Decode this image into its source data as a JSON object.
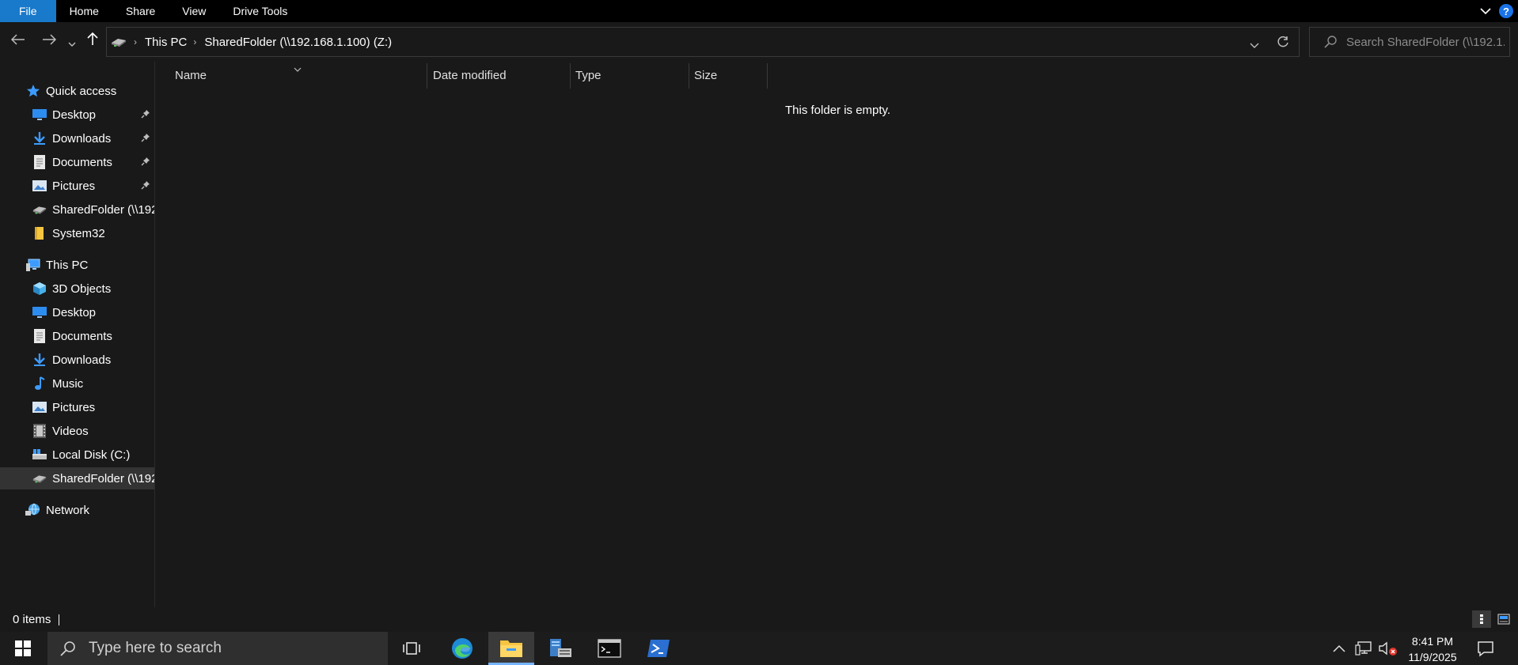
{
  "ribbon": {
    "tabs": [
      "File",
      "Home",
      "Share",
      "View",
      "Drive Tools"
    ]
  },
  "address": {
    "crumbs": [
      "This PC",
      "SharedFolder (\\\\192.168.1.100) (Z:)"
    ]
  },
  "search": {
    "placeholder": "Search SharedFolder (\\\\192.1..."
  },
  "nav": {
    "quick_access": "Quick access",
    "quick_items": [
      {
        "label": "Desktop",
        "icon": "desktop-icon",
        "pinned": true
      },
      {
        "label": "Downloads",
        "icon": "downloads-icon",
        "pinned": true
      },
      {
        "label": "Documents",
        "icon": "documents-icon",
        "pinned": true
      },
      {
        "label": "Pictures",
        "icon": "pictures-icon",
        "pinned": true
      },
      {
        "label": "SharedFolder (\\\\192",
        "icon": "network-drive-icon",
        "pinned": false
      },
      {
        "label": "System32",
        "icon": "folder-icon",
        "pinned": false
      }
    ],
    "this_pc": "This PC",
    "pc_items": [
      {
        "label": "3D Objects",
        "icon": "3d-objects-icon"
      },
      {
        "label": "Desktop",
        "icon": "desktop-icon"
      },
      {
        "label": "Documents",
        "icon": "documents-icon"
      },
      {
        "label": "Downloads",
        "icon": "downloads-icon"
      },
      {
        "label": "Music",
        "icon": "music-icon"
      },
      {
        "label": "Pictures",
        "icon": "pictures-icon"
      },
      {
        "label": "Videos",
        "icon": "videos-icon"
      },
      {
        "label": "Local Disk (C:)",
        "icon": "local-disk-icon"
      },
      {
        "label": "SharedFolder (\\\\192",
        "icon": "network-drive-icon"
      }
    ],
    "network": "Network"
  },
  "columns": {
    "name": "Name",
    "date": "Date modified",
    "type": "Type",
    "size": "Size"
  },
  "content": {
    "empty_message": "This folder is empty."
  },
  "status": {
    "item_count": "0 items"
  },
  "taskbar": {
    "search_placeholder": "Type here to search",
    "time": "8:41 PM",
    "date": "11/9/2025"
  },
  "colors": {
    "accent": "#1979ca",
    "background": "#191919",
    "selected": "#333333"
  }
}
